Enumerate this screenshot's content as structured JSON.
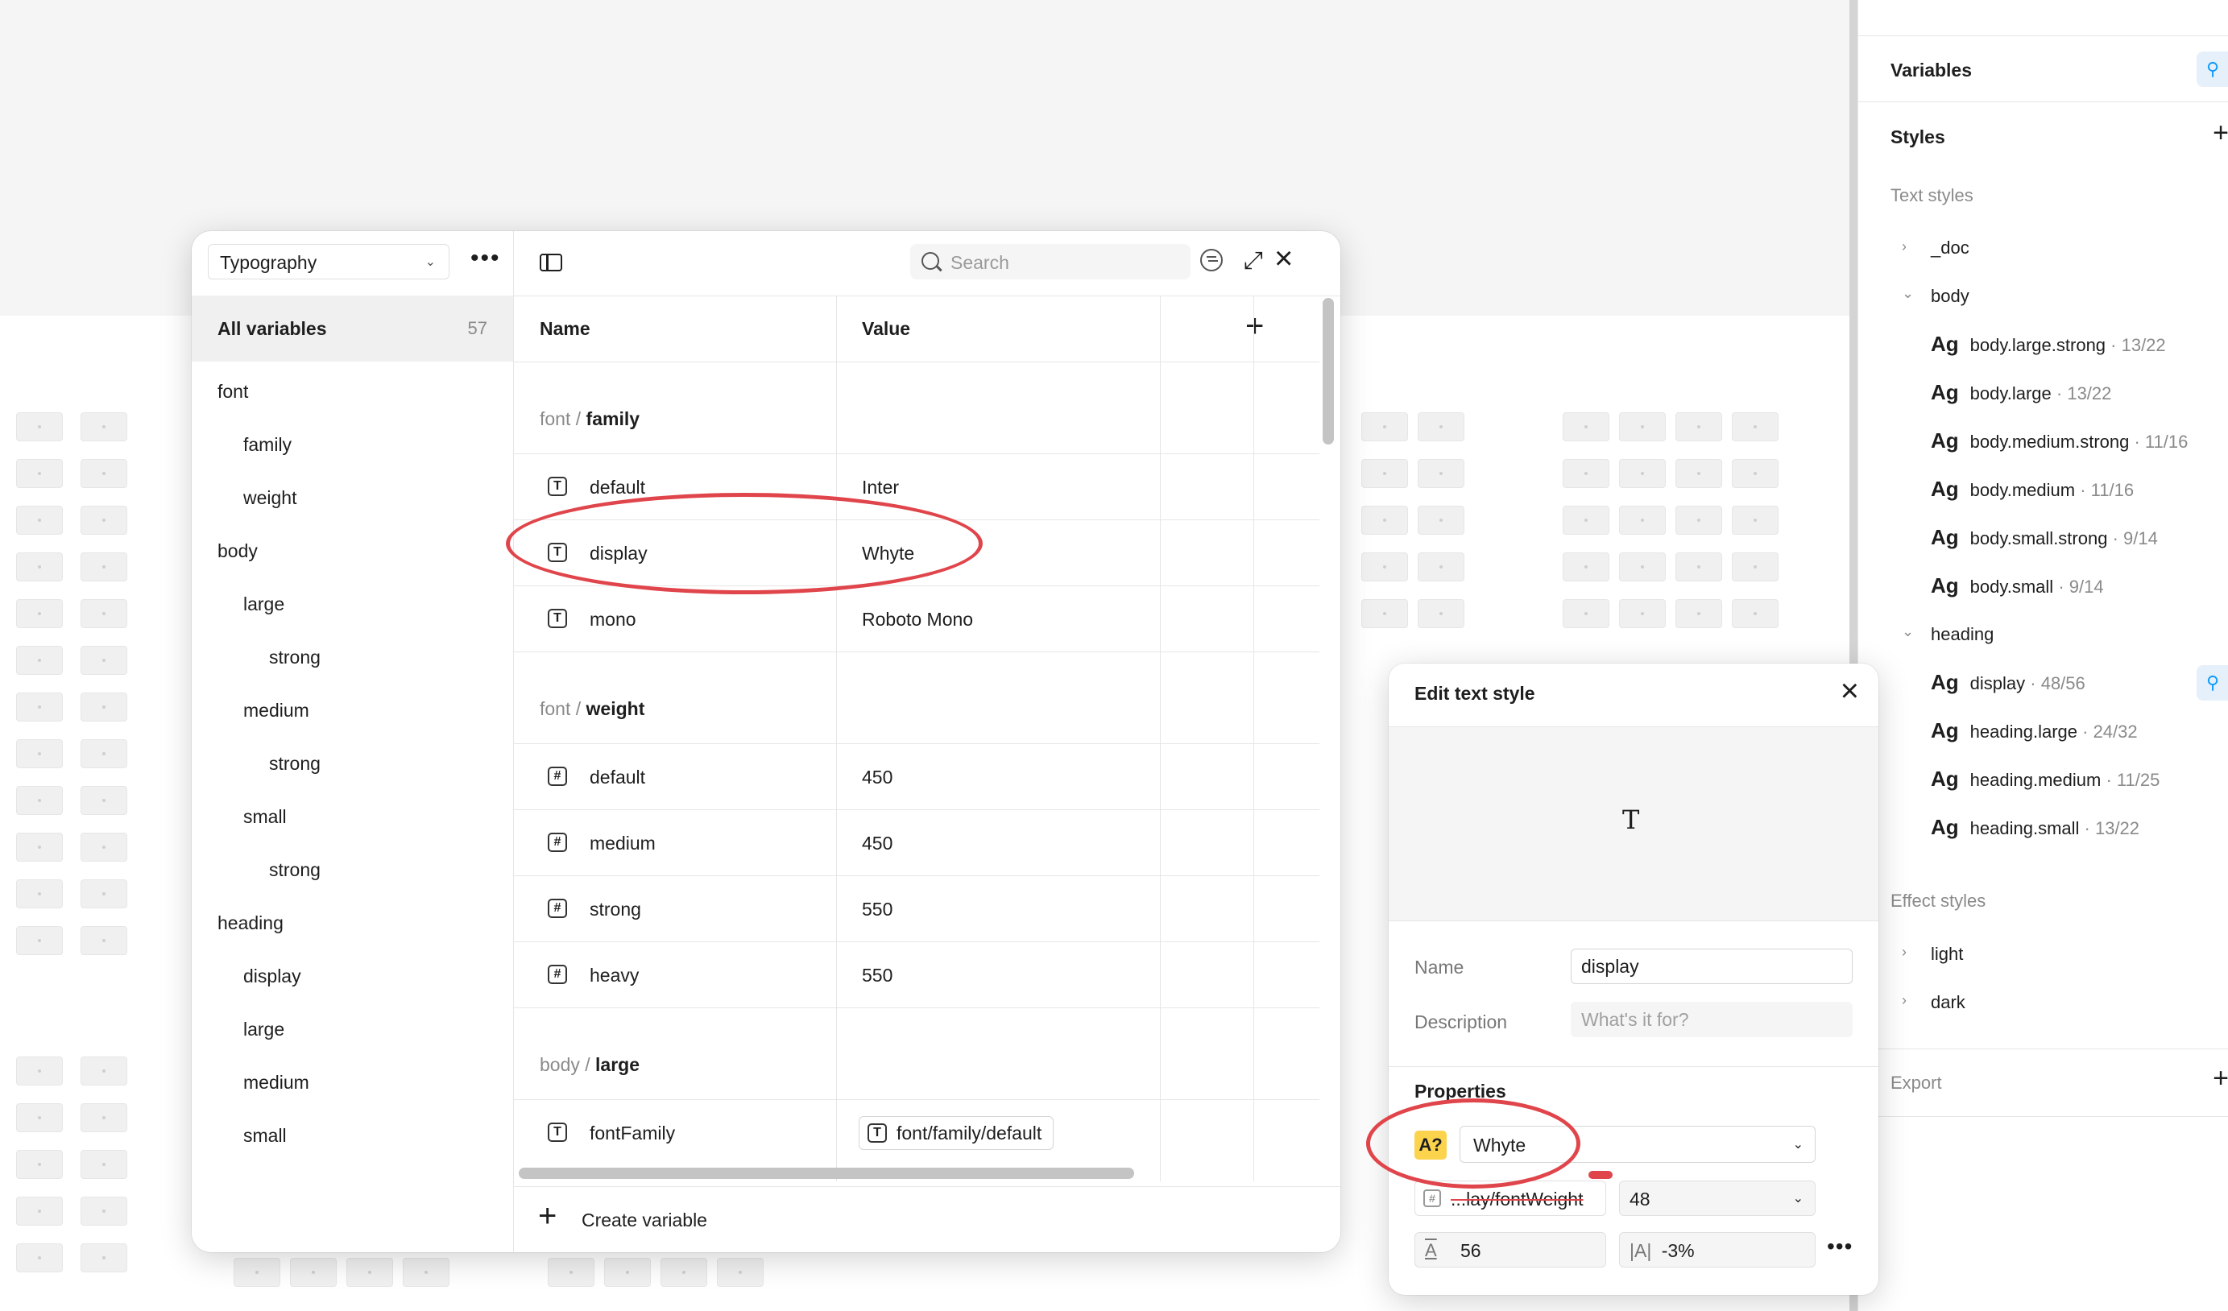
{
  "right_panel": {
    "variables_label": "Variables",
    "styles_label": "Styles",
    "text_styles_label": "Text styles",
    "text_groups": [
      {
        "name": "_doc",
        "expanded": false,
        "items": []
      },
      {
        "name": "body",
        "expanded": true,
        "items": [
          {
            "ag": "Ag",
            "name": "body.large.strong",
            "meta": " · 13/22"
          },
          {
            "ag": "Ag",
            "name": "body.large",
            "meta": " · 13/22"
          },
          {
            "ag": "Ag",
            "name": "body.medium.strong",
            "meta": " · 11/16"
          },
          {
            "ag": "Ag",
            "name": "body.medium",
            "meta": " · 11/16"
          },
          {
            "ag": "Ag",
            "name": "body.small.strong",
            "meta": " · 9/14"
          },
          {
            "ag": "Ag",
            "name": "body.small",
            "meta": " · 9/14"
          }
        ]
      },
      {
        "name": "heading",
        "expanded": true,
        "items": [
          {
            "ag": "Ag",
            "name": "display",
            "meta": " · 48/56"
          },
          {
            "ag": "Ag",
            "name": "heading.large",
            "meta": " · 24/32"
          },
          {
            "ag": "Ag",
            "name": "heading.medium",
            "meta": " · 11/25"
          },
          {
            "ag": "Ag",
            "name": "heading.small",
            "meta": " · 13/22"
          }
        ]
      }
    ],
    "effect_styles_label": "Effect styles",
    "effect_items": [
      "light",
      "dark"
    ],
    "export_label": "Export"
  },
  "variables_modal": {
    "collection": "Typography",
    "all_variables_label": "All variables",
    "all_variables_count": "57",
    "tree": {
      "font": "font",
      "family": "family",
      "weight": "weight",
      "body": "body",
      "large": "large",
      "large_strong": "strong",
      "medium": "medium",
      "medium_strong": "strong",
      "small": "small",
      "small_strong": "strong",
      "heading": "heading",
      "h_display": "display",
      "h_large": "large",
      "h_medium": "medium",
      "h_small": "small"
    },
    "search_placeholder": "Search",
    "col_name": "Name",
    "col_value": "Value",
    "groups": {
      "family": {
        "prefix": "font / ",
        "name": "family"
      },
      "weight": {
        "prefix": "font / ",
        "name": "weight"
      },
      "body_large": {
        "prefix": "body / ",
        "name": "large"
      }
    },
    "rows": {
      "fam_default": {
        "name": "default",
        "value": "Inter",
        "icon": "T"
      },
      "fam_display": {
        "name": "display",
        "value": "Whyte",
        "icon": "T"
      },
      "fam_mono": {
        "name": "mono",
        "value": "Roboto Mono",
        "icon": "T"
      },
      "w_default": {
        "name": "default",
        "value": "450",
        "icon": "#"
      },
      "w_medium": {
        "name": "medium",
        "value": "450",
        "icon": "#"
      },
      "w_strong": {
        "name": "strong",
        "value": "550",
        "icon": "#"
      },
      "w_heavy": {
        "name": "heavy",
        "value": "550",
        "icon": "#"
      },
      "bl_fontFamily": {
        "name": "fontFamily",
        "value": "font/family/default",
        "icon": "T"
      }
    },
    "create_variable": "Create variable"
  },
  "edit_text_style": {
    "title": "Edit text style",
    "preview_glyph": "T",
    "name_label": "Name",
    "name_value": "display",
    "description_label": "Description",
    "description_placeholder": "What's it for?",
    "properties_label": "Properties",
    "font_badge": "A?",
    "font_value": "Whyte",
    "weight_binding": "...lay/fontWeight",
    "font_size": "48",
    "line_height": "56",
    "letter_spacing_icon": "|A|",
    "letter_spacing": "-3%"
  },
  "colors": {
    "annotation_red": "#e0454b",
    "missing_font_badge": "#fcd34d",
    "accent_blue": "#0d99ff"
  }
}
